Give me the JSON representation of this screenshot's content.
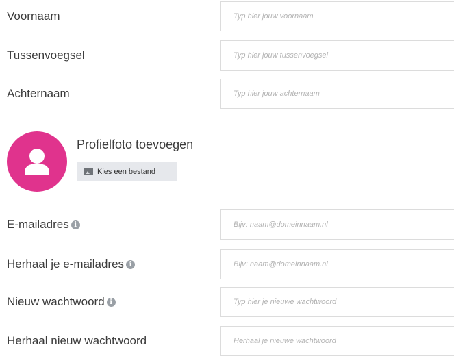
{
  "fields": {
    "first_name": {
      "label": "Voornaam",
      "placeholder": "Typ hier jouw voornaam"
    },
    "infix": {
      "label": "Tussenvoegsel",
      "placeholder": "Typ hier jouw tussenvoegsel"
    },
    "last_name": {
      "label": "Achternaam",
      "placeholder": "Typ hier jouw achternaam"
    },
    "email": {
      "label": "E-mailadres",
      "placeholder": "Bijv: naam@domeinnaam.nl",
      "info_icon": "info-icon"
    },
    "email_repeat": {
      "label": "Herhaal je e-mailadres",
      "placeholder": "Bijv: naam@domeinnaam.nl",
      "info_icon": "info-icon"
    },
    "new_password": {
      "label": "Nieuw wachtwoord",
      "placeholder": "Typ hier je nieuwe wachtwoord",
      "info_icon": "info-icon"
    },
    "new_password_repeat": {
      "label": "Herhaal nieuw wachtwoord",
      "placeholder": "Herhaal je nieuwe wachtwoord"
    }
  },
  "profile_photo": {
    "title": "Profielfoto toevoegen",
    "button_label": "Kies een bestand",
    "button_icon": "image-icon",
    "avatar_icon": "user-icon",
    "avatar_color": "#e0338d"
  }
}
